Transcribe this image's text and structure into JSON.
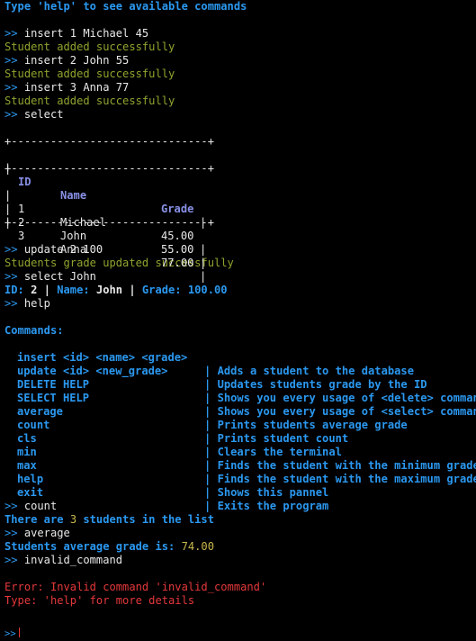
{
  "banner": "Type 'help' to see available commands",
  "prompt": ">>",
  "session": {
    "cmd_insert1": "insert 1 Michael 45",
    "out_added": "Student added successfully",
    "cmd_insert2": "insert 2 John 55",
    "cmd_insert3": "insert 3 Anna 77",
    "cmd_select": "select",
    "cmd_update": "update 2 100",
    "out_updated": "Students grade updated successfully",
    "cmd_select_john": "select John",
    "select_john_result": {
      "id_label": "ID:",
      "id_value": "2",
      "name_label": "Name:",
      "name_value": "John",
      "grade_label": "Grade:",
      "grade_value": "100.00",
      "separator": "|"
    },
    "cmd_help": "help",
    "cmd_count": "count",
    "count_result": {
      "prefix": "There are",
      "number": "3",
      "suffix": "students in the list"
    },
    "cmd_average": "average",
    "average_result": {
      "label": "Students average grade is:",
      "value": "74.00"
    },
    "cmd_invalid": "invalid_command",
    "error_line": "Error: Invalid command 'invalid_command'",
    "error_hint": "Type: 'help' for more details"
  },
  "table": {
    "border": "+------------------------------+",
    "left_edge": "|",
    "right_edge": "|",
    "headers": {
      "id": "ID",
      "name": "Name",
      "grade": "Grade"
    },
    "rows": [
      {
        "id": "1",
        "name": "Michael",
        "grade": "45.00"
      },
      {
        "id": "2",
        "name": "John",
        "grade": "55.00"
      },
      {
        "id": "3",
        "name": "Anna",
        "grade": "77.00"
      }
    ]
  },
  "help": {
    "title": "Commands:",
    "separator": "|",
    "commands": [
      {
        "usage": "insert <id> <name> <grade>",
        "desc": "Adds a student to the database"
      },
      {
        "usage": "update <id> <new_grade>",
        "desc": "Updates students grade by the ID"
      },
      {
        "usage": "DELETE HELP",
        "desc": "Shows you every usage of <delete> command"
      },
      {
        "usage": "SELECT HELP",
        "desc": "Shows you every usage of <select> command"
      },
      {
        "usage": "average",
        "desc": "Prints students average grade"
      },
      {
        "usage": "count",
        "desc": "Prints student count"
      },
      {
        "usage": "cls",
        "desc": "Clears the terminal"
      },
      {
        "usage": "min",
        "desc": "Finds the student with the minimum grade"
      },
      {
        "usage": "max",
        "desc": "Finds the student with the maximum grade"
      },
      {
        "usage": "help",
        "desc": "Shows this pannel"
      },
      {
        "usage": "exit",
        "desc": "Exits the program"
      }
    ]
  },
  "colors": {
    "background": "#000000",
    "text": "#e8e8e8",
    "accent_blue": "#2b98f0",
    "success_green": "#8fa52f",
    "table_header_violet": "#8890e6",
    "error_red": "#e5383b",
    "number_yellow": "#c9b84c"
  }
}
